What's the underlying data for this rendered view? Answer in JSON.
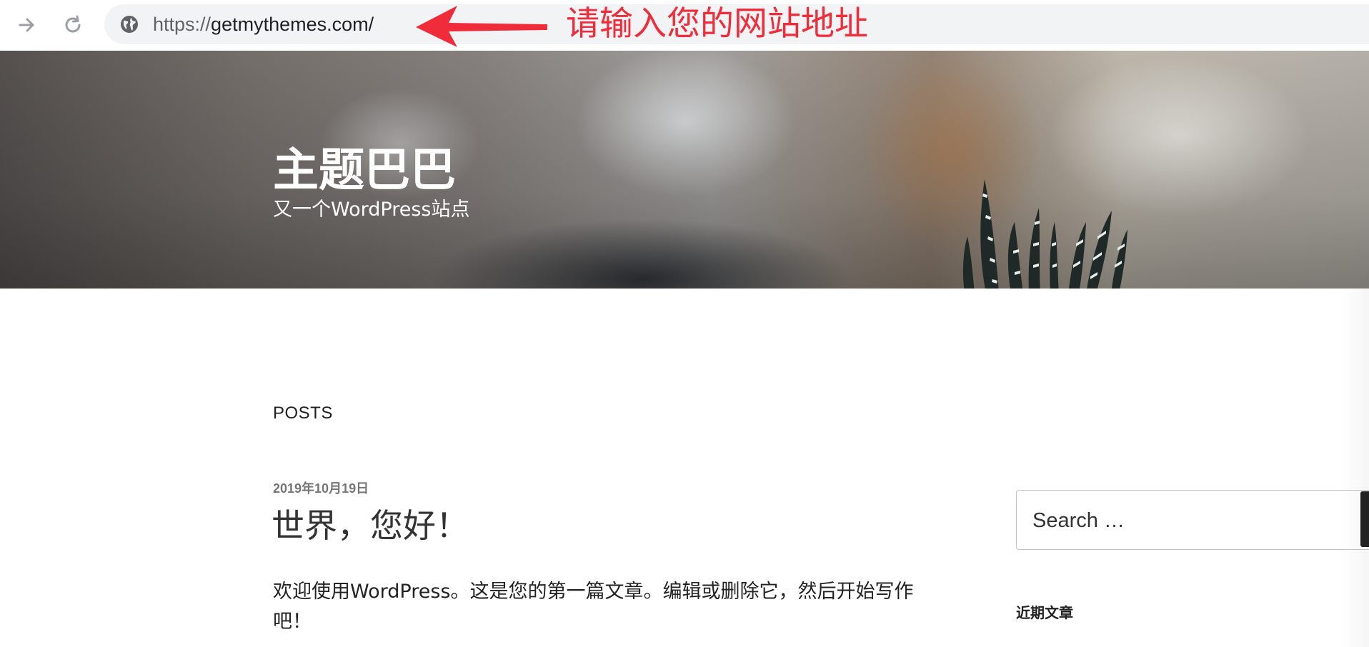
{
  "browser": {
    "url_scheme": "https://",
    "url_rest": "getmythemes.com/",
    "icons": {
      "forward": "arrow-right-icon",
      "reload": "reload-icon",
      "site_info": "globe-icon"
    }
  },
  "annotation": {
    "text": "请输入您的网站地址",
    "color": "#f12c3a"
  },
  "header": {
    "site_title": "主题巴巴",
    "site_description": "又一个WordPress站点"
  },
  "main": {
    "section_heading": "POSTS",
    "posts": [
      {
        "date": "2019年10月19日",
        "title": "世界，您好！",
        "excerpt": "欢迎使用WordPress。这是您的第一篇文章。编辑或删除它，然后开始写作吧！"
      }
    ]
  },
  "sidebar": {
    "search_placeholder": "Search …",
    "recent_posts_heading": "近期文章"
  }
}
